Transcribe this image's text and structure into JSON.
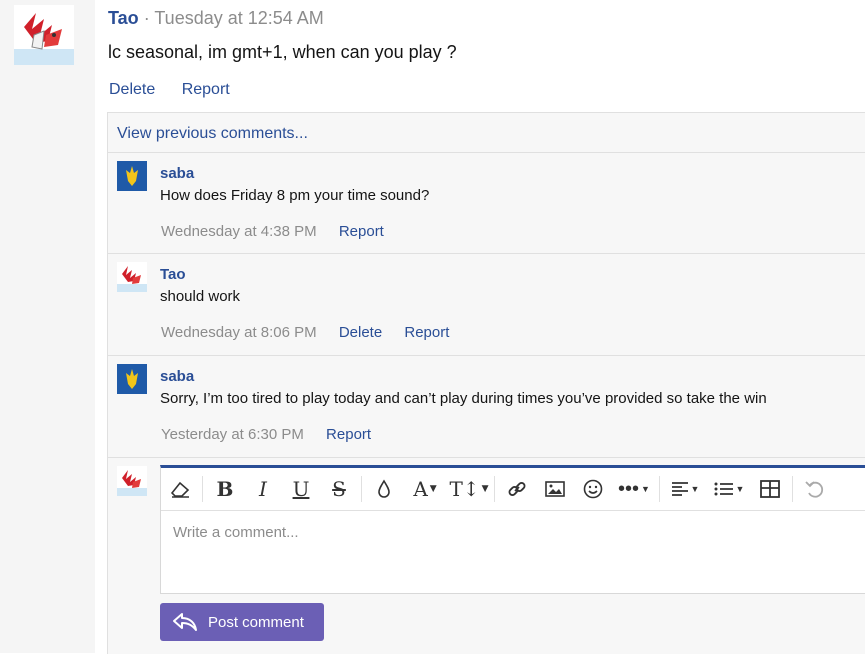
{
  "post": {
    "author": "Tao",
    "time": "· Tuesday at 12:54 AM",
    "body": "lc seasonal, im gmt+1, when can you play ?",
    "actions": {
      "delete": "Delete",
      "report": "Report"
    }
  },
  "comments_section": {
    "view_previous": "View previous comments...",
    "comments": [
      {
        "author": "saba",
        "text": "How does Friday 8 pm your time sound?",
        "time": "Wednesday at 4:38 PM",
        "report": "Report"
      },
      {
        "author": "Tao",
        "text": "should work",
        "time": "Wednesday at 8:06 PM",
        "delete": "Delete",
        "report": "Report"
      },
      {
        "author": "saba",
        "text": "Sorry, I’m too tired to play today and can’t play during times you’ve provided so take the win",
        "time": "Yesterday at 6:30 PM",
        "report": "Report"
      }
    ]
  },
  "editor": {
    "placeholder": "Write a comment...",
    "toolbar": [
      "eraser-icon",
      "bold-icon",
      "italic-icon",
      "underline-icon",
      "strikethrough-icon",
      "color-icon",
      "font-family-icon",
      "font-size-icon",
      "link-icon",
      "image-icon",
      "smiley-icon",
      "more-icon",
      "align-icon",
      "list-icon",
      "table-icon",
      "undo-icon"
    ]
  },
  "post_button": {
    "label": "Post comment"
  },
  "colors": {
    "link": "#2a4e96",
    "muted": "#8c8c8c",
    "button": "#6b5fb5",
    "accent": "#2a4e96"
  }
}
